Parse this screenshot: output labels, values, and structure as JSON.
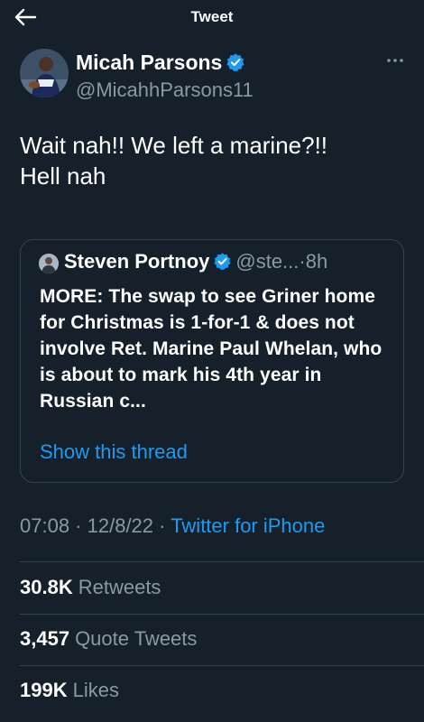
{
  "header": {
    "title": "Tweet",
    "back_icon": "arrow-left-icon"
  },
  "author": {
    "name": "Micah Parsons",
    "handle": "@MicahhParsons11",
    "verified": true,
    "verified_color": "#1d9bf0"
  },
  "tweet": {
    "text": "Wait nah!! We left a marine?!!\nHell nah"
  },
  "quote": {
    "name": "Steven Portnoy",
    "handle": "@ste...",
    "separator": "·",
    "time": "8h",
    "text": "MORE: The swap to see Griner home for Christmas is 1-for-1 & does not involve Ret. Marine Paul Whelan, who is about to mark his 4th year in Russian c...",
    "show_thread": "Show this thread"
  },
  "meta": {
    "time": "07:08",
    "sep1": " · ",
    "date": "12/8/22",
    "sep2": " · ",
    "source": "Twitter for iPhone"
  },
  "stats": {
    "retweets_count": "30.8K",
    "retweets_label": "Retweets",
    "quotes_count": "3,457",
    "quotes_label": "Quote Tweets",
    "likes_count": "199K",
    "likes_label": "Likes"
  },
  "colors": {
    "background": "#15202b",
    "text": "#ffffff",
    "secondary_text": "#8b98a5",
    "link": "#1d9bf0",
    "border": "#38444d"
  }
}
